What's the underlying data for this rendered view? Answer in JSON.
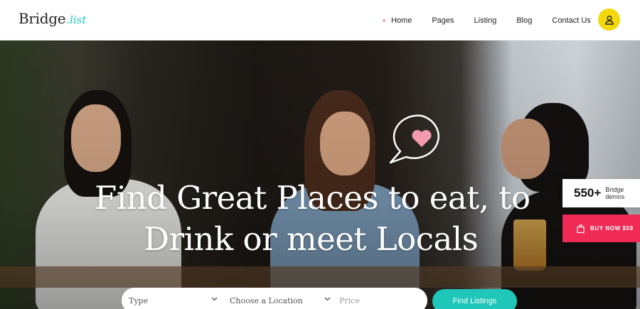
{
  "logo": {
    "main": "Bridge",
    "suffix": "list"
  },
  "nav": {
    "items": [
      {
        "label": "Home",
        "active": true
      },
      {
        "label": "Pages"
      },
      {
        "label": "Listing"
      },
      {
        "label": "Blog"
      },
      {
        "label": "Contact Us"
      }
    ]
  },
  "user_button": {
    "icon": "user-icon",
    "color": "#f3d80b"
  },
  "hero": {
    "title_line1": "Find Great Places to eat, to",
    "title_line2": "Drink or meet Locals",
    "bubble_icon": "heart-speech-bubble-icon"
  },
  "demos_badge": {
    "count": "550+",
    "label_line1": "Bridge",
    "label_line2": "demos"
  },
  "buy_button": {
    "label": "BUY NOW $59",
    "icon": "bag-icon",
    "color": "#ef2b55"
  },
  "search": {
    "type_placeholder": "Type",
    "location_placeholder": "Choose a Location",
    "price_placeholder": "Price",
    "submit_label": "Find Listings",
    "accent": "#1fc7b9"
  }
}
